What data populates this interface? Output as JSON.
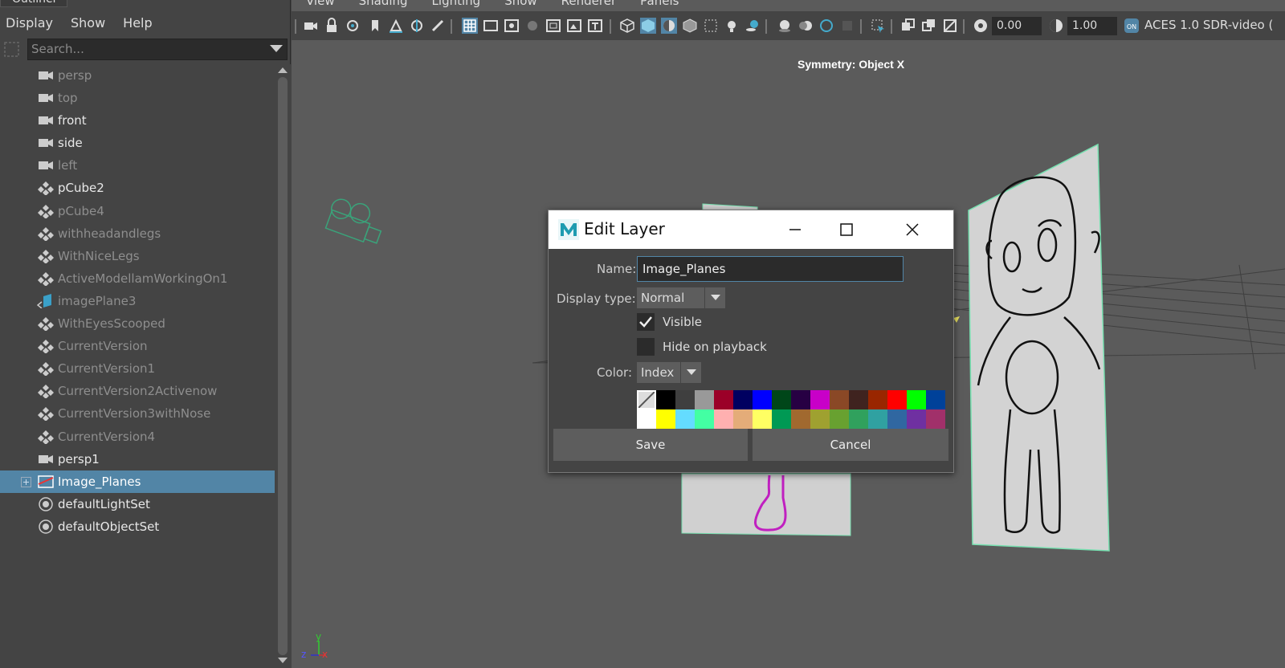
{
  "outliner": {
    "title": "Outliner",
    "menu": [
      "Display",
      "Show",
      "Help"
    ],
    "search_placeholder": "Search...",
    "items": [
      {
        "label": "persp",
        "type": "camera",
        "dim": true
      },
      {
        "label": "top",
        "type": "camera",
        "dim": true
      },
      {
        "label": "front",
        "type": "camera",
        "dim": false
      },
      {
        "label": "side",
        "type": "camera",
        "dim": false
      },
      {
        "label": "left",
        "type": "camera",
        "dim": true
      },
      {
        "label": "pCube2",
        "type": "mesh",
        "dim": false
      },
      {
        "label": "pCube4",
        "type": "mesh",
        "dim": true
      },
      {
        "label": "withheadandlegs",
        "type": "mesh",
        "dim": true
      },
      {
        "label": "WithNiceLegs",
        "type": "mesh",
        "dim": true
      },
      {
        "label": "ActiveModellamWorkingOn1",
        "type": "mesh",
        "dim": true
      },
      {
        "label": "imagePlane3",
        "type": "imageplane",
        "dim": true
      },
      {
        "label": "WithEyesScooped",
        "type": "mesh",
        "dim": true
      },
      {
        "label": "CurrentVersion",
        "type": "mesh",
        "dim": true
      },
      {
        "label": "CurrentVersion1",
        "type": "mesh",
        "dim": true
      },
      {
        "label": "CurrentVersion2Activenow",
        "type": "mesh",
        "dim": true
      },
      {
        "label": "CurrentVersion3withNose",
        "type": "mesh",
        "dim": true
      },
      {
        "label": "CurrentVersion4",
        "type": "mesh",
        "dim": true
      },
      {
        "label": "persp1",
        "type": "camera",
        "dim": false
      },
      {
        "label": "Image_Planes",
        "type": "layer",
        "dim": false,
        "selected": true
      },
      {
        "label": "defaultLightSet",
        "type": "set",
        "dim": false
      },
      {
        "label": "defaultObjectSet",
        "type": "set",
        "dim": false
      }
    ]
  },
  "viewport": {
    "menu": [
      "View",
      "Shading",
      "Lighting",
      "Show",
      "Renderer",
      "Panels"
    ],
    "exposure": "0.00",
    "gamma": "1.00",
    "color_space": "ACES 1.0 SDR-video (",
    "symmetry": "Symmetry: Object X",
    "axis": {
      "y": "y",
      "z": "z",
      "x": "x"
    }
  },
  "dialog": {
    "title": "Edit Layer",
    "name_label": "Name:",
    "name_value": "Image_Planes",
    "display_type_label": "Display type:",
    "display_type_value": "Normal",
    "visible_label": "Visible",
    "visible_checked": true,
    "hide_playback_label": "Hide on playback",
    "hide_playback_checked": false,
    "color_label": "Color:",
    "color_mode": "Index",
    "palette_row1": [
      "none",
      "#000000",
      "#3f3f3f",
      "#999999",
      "#9b0028",
      "#000060",
      "#0000ff",
      "#004619",
      "#270043",
      "#c800c8",
      "#8a4826",
      "#3f231f",
      "#992600",
      "#ff0000",
      "#00ff00",
      "#004199"
    ],
    "palette_row2": [
      "#ffffff",
      "#ffff00",
      "#64dcff",
      "#43ffa3",
      "#ffb0b0",
      "#e4ac79",
      "#ffff63",
      "#009954",
      "#a1692f",
      "#9fa130",
      "#68a130",
      "#30a15d",
      "#30a1a1",
      "#3067a1",
      "#6f30a1",
      "#a1306a"
    ],
    "save_label": "Save",
    "cancel_label": "Cancel",
    "accent": "#5285a6"
  }
}
